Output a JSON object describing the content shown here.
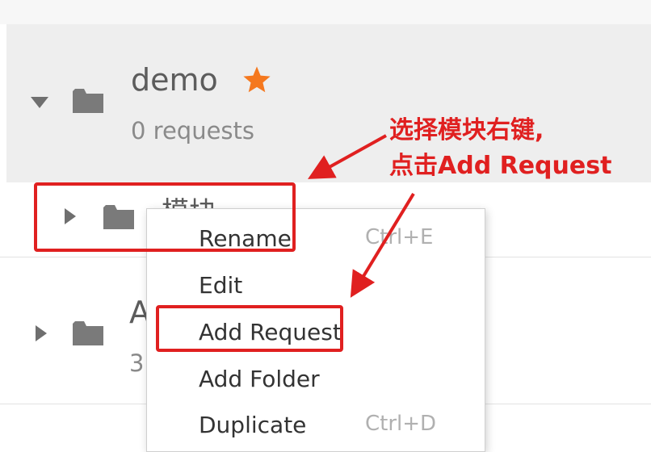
{
  "collections": [
    {
      "name": "demo",
      "count_text": "0 requests",
      "starred": true
    },
    {
      "name": "模块",
      "count_text": ""
    },
    {
      "name": "A",
      "count_text": "3"
    }
  ],
  "context_menu": {
    "items": [
      {
        "label": "Rename",
        "shortcut": "Ctrl+E"
      },
      {
        "label": "Edit",
        "shortcut": ""
      },
      {
        "label": "Add Request",
        "shortcut": ""
      },
      {
        "label": "Add Folder",
        "shortcut": ""
      },
      {
        "label": "Duplicate",
        "shortcut": "Ctrl+D"
      }
    ]
  },
  "annotation": {
    "line1": "选择模块右键,",
    "line2": "点击Add Request"
  },
  "colors": {
    "annotation": "#e02020",
    "star": "#f5781e",
    "folder": "#7a7a7a",
    "panel": "#eeeeee"
  },
  "icons": [
    "caret-down-icon",
    "caret-right-icon",
    "folder-icon",
    "star-icon"
  ]
}
